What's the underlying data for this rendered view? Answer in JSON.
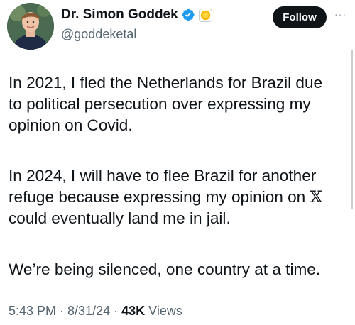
{
  "author": {
    "display_name": "Dr. Simon Goddek",
    "handle": "@goddeketal",
    "verified_icon": "verified-badge-icon",
    "affiliate_icon": "gold-affiliate-badge-icon",
    "verified_color": "#1d9bf0",
    "affiliate_color": "#f5b700"
  },
  "actions": {
    "follow_label": "Follow",
    "more_icon": "more-options-icon",
    "more_label": "···"
  },
  "tweet": {
    "paragraph1": "In 2021, I fled the Netherlands for Brazil due\nto political persecution over expressing my\nopinion on Covid.",
    "paragraph2_before_x": "In 2024, I will have to flee Brazil for another\nrefuge because expressing my opinion on ",
    "x_symbol": "𝕏",
    "paragraph2_after_x": "\ncould eventually land me in jail.",
    "paragraph3": "We’re being silenced, one country at a time."
  },
  "meta": {
    "time": "5:43 PM",
    "date": "8/31/24",
    "views_count": "43K",
    "views_label": "Views",
    "separator": "·"
  }
}
